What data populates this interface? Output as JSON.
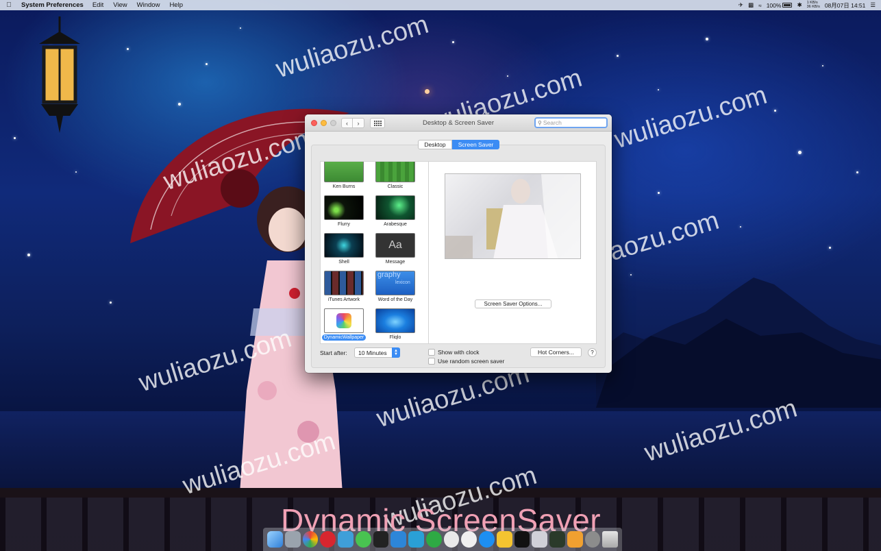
{
  "menubar": {
    "app_name": "System Preferences",
    "menus": [
      "Edit",
      "View",
      "Window",
      "Help"
    ],
    "net_up": "1 KB/s",
    "net_down": "36 KB/s",
    "battery": "100%",
    "clock": "08月07日 14:51"
  },
  "window": {
    "title": "Desktop & Screen Saver",
    "search_placeholder": "Search",
    "tabs": [
      "Desktop",
      "Screen Saver"
    ],
    "selected_tab": "Screen Saver",
    "savers": [
      {
        "label": "Ken Burns"
      },
      {
        "label": "Classic"
      },
      {
        "label": "Flurry"
      },
      {
        "label": "Arabesque"
      },
      {
        "label": "Shell"
      },
      {
        "label": "Message"
      },
      {
        "label": "iTunes Artwork"
      },
      {
        "label": "Word of the Day"
      },
      {
        "label": "DynamicWallpaper",
        "selected": true
      },
      {
        "label": "Fliqlo"
      }
    ],
    "message_thumb_text": "Aa",
    "word_thumb_text": "graphy",
    "word_thumb_text2": "lexicon",
    "options_button": "Screen Saver Options...",
    "start_after_label": "Start after:",
    "start_after_value": "10 Minutes",
    "show_clock_label": "Show with clock",
    "random_label": "Use random screen saver",
    "hot_corners_button": "Hot Corners...",
    "help_button": "?"
  },
  "watermark": "wuliaozu.com",
  "caption": "Dynamic ScreenSaver",
  "colors": {
    "accent": "#3b8cf4",
    "caption": "#f0a0b4"
  }
}
